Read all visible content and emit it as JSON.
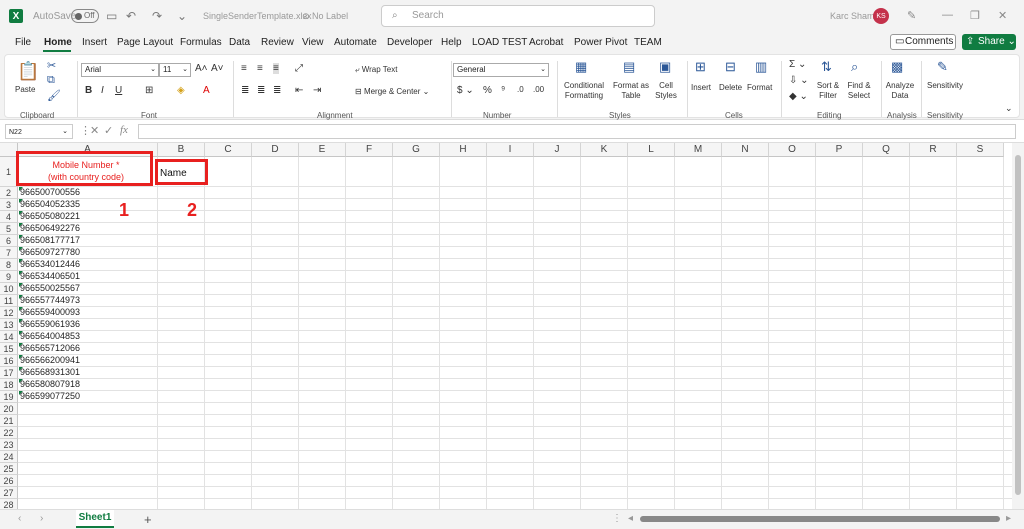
{
  "titlebar": {
    "app_icon": "X",
    "autosave_label": "AutoSave",
    "autosave_state": "Off",
    "filename": "SingleSenderTemplate.xlsx",
    "sensitivity": "No Label",
    "search_placeholder": "Search",
    "user_name": "Karc Sham",
    "user_initials": "KS"
  },
  "menu": {
    "items": [
      "File",
      "Home",
      "Insert",
      "Page Layout",
      "Formulas",
      "Data",
      "Review",
      "View",
      "Automate",
      "Developer",
      "Help",
      "LOAD TEST",
      "Acrobat",
      "Power Pivot",
      "TEAM"
    ],
    "active": "Home",
    "comments_label": "Comments",
    "share_label": "Share"
  },
  "ribbon": {
    "clipboard": {
      "paste": "Paste",
      "label": "Clipboard"
    },
    "font": {
      "name": "Arial",
      "size": "11",
      "label": "Font"
    },
    "alignment": {
      "wrap": "Wrap Text",
      "merge": "Merge & Center",
      "label": "Alignment"
    },
    "number": {
      "format": "General",
      "label": "Number"
    },
    "styles": {
      "conditional": "Conditional Formatting",
      "format_table": "Format as Table",
      "cell_styles": "Cell Styles",
      "label": "Styles"
    },
    "cells": {
      "insert": "Insert",
      "delete": "Delete",
      "format": "Format",
      "label": "Cells"
    },
    "editing": {
      "sort": "Sort & Filter",
      "find": "Find & Select",
      "label": "Editing"
    },
    "analysis": {
      "analyze": "Analyze Data",
      "label": "Analysis"
    },
    "sensitivity": {
      "sensitivity": "Sensitivity",
      "label": "Sensitivity"
    }
  },
  "formula_bar": {
    "name_box": "N22",
    "fx": "fx",
    "content": ""
  },
  "grid": {
    "columns": [
      "A",
      "B",
      "C",
      "D",
      "E",
      "F",
      "G",
      "H",
      "I",
      "J",
      "K",
      "L",
      "M",
      "N",
      "O",
      "P",
      "Q",
      "R",
      "S"
    ],
    "rows": [
      "1",
      "2",
      "3",
      "4",
      "5",
      "6",
      "7",
      "8",
      "9",
      "10",
      "11",
      "12",
      "13",
      "14",
      "15",
      "16",
      "17",
      "18",
      "19",
      "20",
      "21",
      "22",
      "23",
      "24",
      "25",
      "26",
      "27",
      "28"
    ],
    "A1_line1": "Mobile Number *",
    "A1_line2": "(with country code)",
    "B1": "Name",
    "phones": [
      "966500700556",
      "966504052335",
      "966505080221",
      "966506492276",
      "966508177717",
      "966509727780",
      "966534012446",
      "966534406501",
      "966550025567",
      "966557744973",
      "966559400093",
      "966559061936",
      "966564004853",
      "966565712066",
      "966566200941",
      "966568931301",
      "966580807918",
      "966599077250"
    ]
  },
  "annotations": {
    "label1": "1",
    "label2": "2"
  },
  "sheets": {
    "tabs": [
      "Sheet1"
    ],
    "add": "+"
  }
}
